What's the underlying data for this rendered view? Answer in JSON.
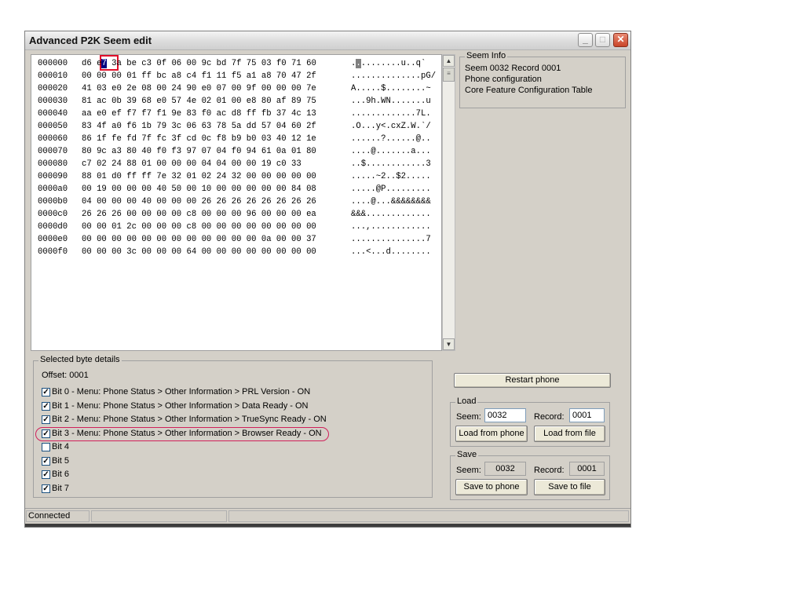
{
  "window": {
    "title": "Advanced P2K Seem edit",
    "min_icon": "minimize-icon",
    "max_icon": "maximize-icon",
    "close_icon": "close-icon"
  },
  "hex": {
    "rows": [
      {
        "offset": "000000",
        "bytes": "d6 e7 3a be c3 0f 06 00 9c bd 7f 75 03 f0 71 60",
        "ascii": "..........u..q`"
      },
      {
        "offset": "000010",
        "bytes": "00 00 00 01 ff bc a8 c4 f1 11 f5 a1 a8 70 47 2f",
        "ascii": "..............pG/"
      },
      {
        "offset": "000020",
        "bytes": "41 03 e0 2e 08 00 24 90 e0 07 00 9f 00 00 00 7e",
        "ascii": "A.....$........~"
      },
      {
        "offset": "000030",
        "bytes": "81 ac 0b 39 68 e0 57 4e 02 01 00 e8 80 af 89 75",
        "ascii": "...9h.WN.......u"
      },
      {
        "offset": "000040",
        "bytes": "aa e0 ef f7 f7 f1 9e 83 f0 ac d8 ff fb 37 4c 13",
        "ascii": ".............7L."
      },
      {
        "offset": "000050",
        "bytes": "83 4f a0 f6 1b 79 3c 06 63 78 5a dd 57 04 60 2f",
        "ascii": ".O...y<.cxZ.W.`/"
      },
      {
        "offset": "000060",
        "bytes": "86 1f fe fd 7f fc 3f cd 0c f8 b9 b0 03 40 12 1e",
        "ascii": "......?......@.."
      },
      {
        "offset": "000070",
        "bytes": "80 9c a3 80 40 f0 f3 97 07 04 f0 94 61 0a 01 80",
        "ascii": "....@.......a..."
      },
      {
        "offset": "000080",
        "bytes": "c7 02 24 88 01 00 00 00 04 04 00 00 19 c0 33",
        "ascii": "..$............3"
      },
      {
        "offset": "000090",
        "bytes": "88 01 d0 ff ff 7e 32 01 02 24 32 00 00 00 00 00",
        "ascii": ".....~2..$2....."
      },
      {
        "offset": "0000a0",
        "bytes": "00 19 00 00 00 40 50 00 10 00 00 00 00 00 84 08",
        "ascii": ".....@P........."
      },
      {
        "offset": "0000b0",
        "bytes": "04 00 00 00 40 00 00 00 26 26 26 26 26 26 26 26",
        "ascii": "....@...&&&&&&&&"
      },
      {
        "offset": "0000c0",
        "bytes": "26 26 26 00 00 00 00 c8 00 00 00 96 00 00 00 ea",
        "ascii": "&&&............."
      },
      {
        "offset": "0000d0",
        "bytes": "00 00 01 2c 00 00 00 c8 00 00 00 00 00 00 00 00",
        "ascii": "...,............"
      },
      {
        "offset": "0000e0",
        "bytes": "00 00 00 00 00 00 00 00 00 00 00 00 0a 00 00 37",
        "ascii": "...............7"
      },
      {
        "offset": "0000f0",
        "bytes": "00 00 00 3c 00 00 00 64 00 00 00 00 00 00 00 00",
        "ascii": "...<...d........"
      }
    ],
    "selected_byte": "e7",
    "selected_ascii": "."
  },
  "seem_info": {
    "legend": "Seem Info",
    "lines": [
      "Seem 0032 Record 0001",
      "Phone configuration",
      "Core Feature Configuration Table"
    ]
  },
  "byte_details": {
    "legend": "Selected byte details",
    "offset": "Offset: 0001",
    "bits": [
      {
        "label": "Bit 0 - Menu: Phone Status > Other Information > PRL Version - ON",
        "checked": true
      },
      {
        "label": "Bit 1 - Menu: Phone Status > Other Information > Data Ready - ON",
        "checked": true
      },
      {
        "label": "Bit 2 - Menu: Phone Status > Other Information > TrueSync Ready - ON",
        "checked": true
      },
      {
        "label": "Bit 3 - Menu: Phone Status > Other Information > Browser Ready - ON",
        "checked": true
      },
      {
        "label": "Bit 4",
        "checked": false
      },
      {
        "label": "Bit 5",
        "checked": true
      },
      {
        "label": "Bit 6",
        "checked": true
      },
      {
        "label": "Bit 7",
        "checked": true
      }
    ]
  },
  "controls": {
    "restart": "Restart phone",
    "load": {
      "legend": "Load",
      "seem_label": "Seem:",
      "seem_value": "0032",
      "record_label": "Record:",
      "record_value": "0001",
      "from_phone": "Load from phone",
      "from_file": "Load from file"
    },
    "save": {
      "legend": "Save",
      "seem_label": "Seem:",
      "seem_value": "0032",
      "record_label": "Record:",
      "record_value": "0001",
      "to_phone": "Save to phone",
      "to_file": "Save to file"
    }
  },
  "status": {
    "text": "Connected"
  }
}
